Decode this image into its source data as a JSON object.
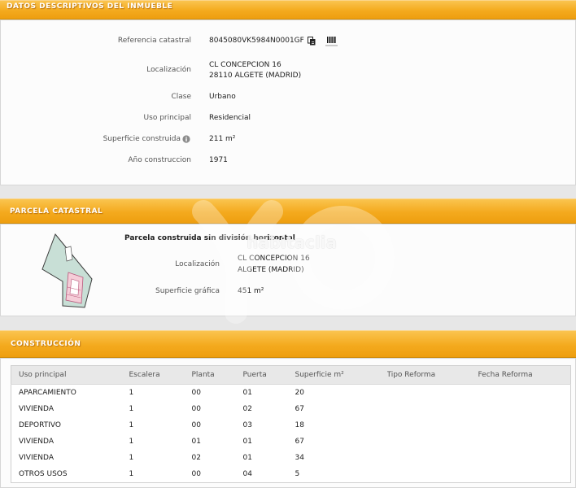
{
  "inmueble": {
    "title": "DATOS DESCRIPTIVOS DEL INMUEBLE",
    "referencia": {
      "label": "Referencia catastral",
      "value": "8045080VK5984N0001GF"
    },
    "localizacion": {
      "label": "Localización",
      "line1": "CL CONCEPCION 16",
      "line2": "28110 ALGETE (MADRID)"
    },
    "clase": {
      "label": "Clase",
      "value": "Urbano"
    },
    "uso": {
      "label": "Uso principal",
      "value": "Residencial"
    },
    "superficie": {
      "label": "Superficie construida",
      "value": "211 m²"
    },
    "anio": {
      "label": "Año construccion",
      "value": "1971"
    }
  },
  "parcela": {
    "title": "PARCELA CATASTRAL",
    "description": "Parcela construida sin división horizontal",
    "localizacion": {
      "label": "Localización",
      "line1": "CL CONCEPCION 16",
      "line2": "ALGETE (MADRID)"
    },
    "superficie": {
      "label": "Superficie gráfica",
      "value": "451 m²"
    }
  },
  "construccion": {
    "title": "CONSTRUCCIÓN",
    "columns": [
      "Uso principal",
      "Escalera",
      "Planta",
      "Puerta",
      "Superficie m²",
      "Tipo Reforma",
      "Fecha Reforma"
    ],
    "rows": [
      [
        "APARCAMIENTO",
        "1",
        "00",
        "01",
        "20"
      ],
      [
        "VIVIENDA",
        "1",
        "00",
        "02",
        "67"
      ],
      [
        "DEPORTIVO",
        "1",
        "00",
        "03",
        "18"
      ],
      [
        "VIVIENDA",
        "1",
        "01",
        "01",
        "67"
      ],
      [
        "VIVIENDA",
        "1",
        "02",
        "01",
        "34"
      ],
      [
        "OTROS USOS",
        "1",
        "00",
        "04",
        "5"
      ]
    ]
  },
  "icons": {
    "copy": "copy-icon",
    "barcode": "barcode-icon",
    "info": "info-icon",
    "parcel_map": "parcel-map-icon"
  },
  "colors": {
    "header_orange": "#f4aa1e",
    "label_gray": "#555555",
    "page_background": "#e7e7e7",
    "parcel_fill": "#c8dfd6",
    "building_fill": "#f5cdd8"
  },
  "watermark": "habitaclia"
}
